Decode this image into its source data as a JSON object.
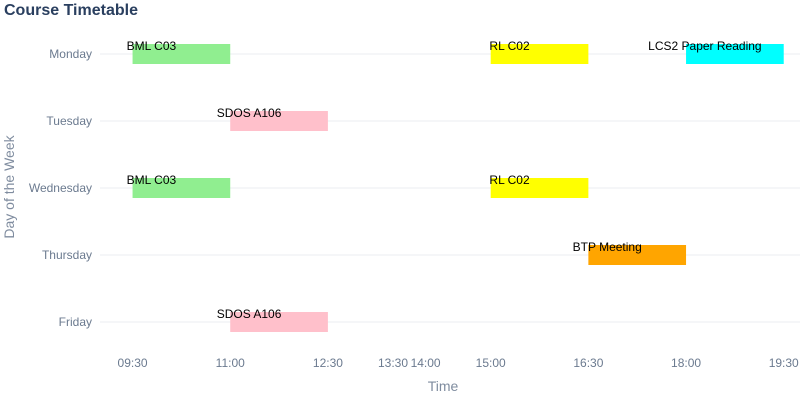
{
  "chart_data": {
    "type": "timeline",
    "title": "Course Timetable",
    "xlabel": "Time",
    "ylabel": "Day of the Week",
    "x_ticks": [
      "09:30",
      "11:00",
      "12:30",
      "13:30",
      "14:00",
      "15:00",
      "16:30",
      "18:00",
      "19:30"
    ],
    "xlim": [
      "09:00",
      "19:45"
    ],
    "categories": [
      "Monday",
      "Tuesday",
      "Wednesday",
      "Thursday",
      "Friday"
    ],
    "grid": "horizontal",
    "events": [
      {
        "label": "BML C03",
        "day": "Monday",
        "start": "09:30",
        "end": "11:00",
        "color": "#90ee90"
      },
      {
        "label": "RL C02",
        "day": "Monday",
        "start": "15:00",
        "end": "16:30",
        "color": "#ffff00"
      },
      {
        "label": "LCS2 Paper Reading",
        "day": "Monday",
        "start": "18:00",
        "end": "19:30",
        "color": "#00ffff"
      },
      {
        "label": "SDOS A106",
        "day": "Tuesday",
        "start": "11:00",
        "end": "12:30",
        "color": "#ffc0cb"
      },
      {
        "label": "BML C03",
        "day": "Wednesday",
        "start": "09:30",
        "end": "11:00",
        "color": "#90ee90"
      },
      {
        "label": "RL C02",
        "day": "Wednesday",
        "start": "15:00",
        "end": "16:30",
        "color": "#ffff00"
      },
      {
        "label": "BTP Meeting",
        "day": "Thursday",
        "start": "16:30",
        "end": "18:00",
        "color": "#ffa500"
      },
      {
        "label": "SDOS A106",
        "day": "Friday",
        "start": "11:00",
        "end": "12:30",
        "color": "#ffc0cb"
      }
    ]
  }
}
